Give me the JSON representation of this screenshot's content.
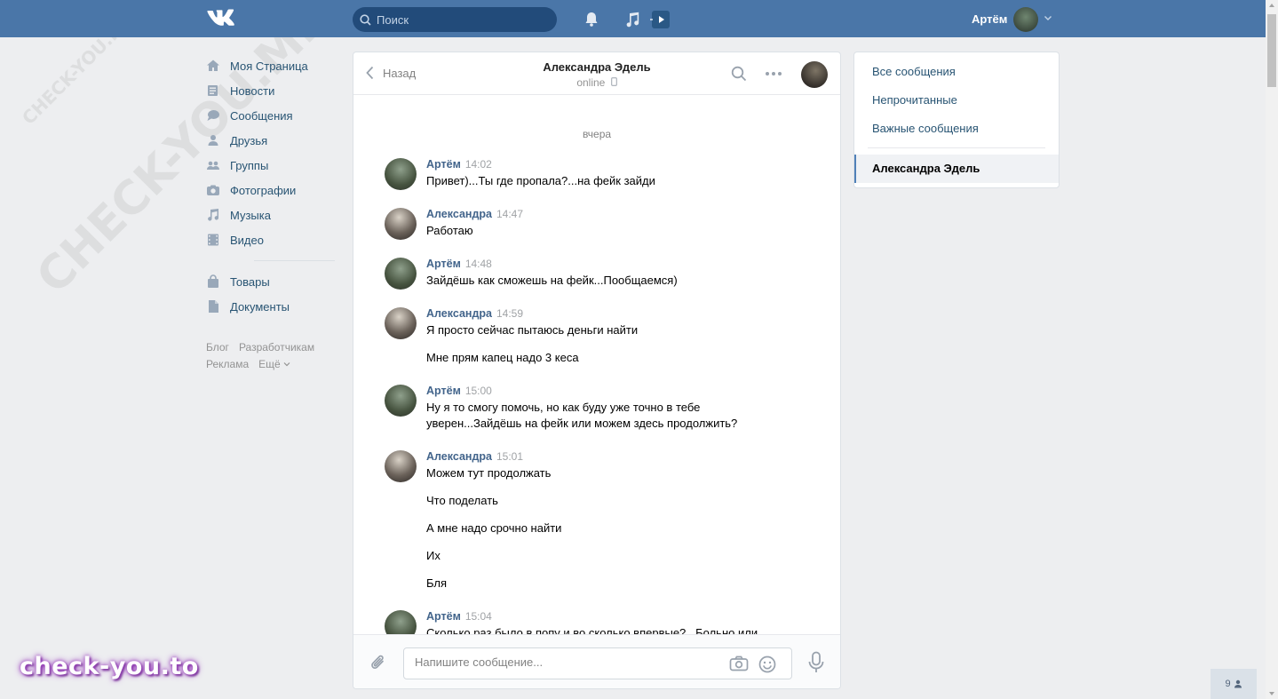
{
  "header": {
    "search_placeholder": "Поиск",
    "user_name": "Артём"
  },
  "watermark": {
    "big": "CHECK-YOU.ME",
    "small": "CHECK-YOU.ME"
  },
  "sidebar": {
    "items": [
      {
        "label": "Моя Страница",
        "icon": "home-icon"
      },
      {
        "label": "Новости",
        "icon": "news-icon"
      },
      {
        "label": "Сообщения",
        "icon": "messages-icon"
      },
      {
        "label": "Друзья",
        "icon": "friends-icon"
      },
      {
        "label": "Группы",
        "icon": "groups-icon"
      },
      {
        "label": "Фотографии",
        "icon": "camera-icon"
      },
      {
        "label": "Музыка",
        "icon": "music-icon"
      },
      {
        "label": "Видео",
        "icon": "video-icon"
      },
      {
        "label": "Товары",
        "icon": "bag-icon"
      },
      {
        "label": "Документы",
        "icon": "document-icon"
      }
    ],
    "footer": [
      "Блог",
      "Разработчикам",
      "Реклама",
      "Ещё"
    ]
  },
  "chat": {
    "back_label": "Назад",
    "peer_name": "Александра Эдель",
    "peer_status": "online",
    "day_label": "вчера",
    "messages": [
      {
        "author": "Артём",
        "time": "14:02",
        "lines": [
          "Привет)...Ты где пропала?...на фейк зайди"
        ]
      },
      {
        "author": "Александра",
        "time": "14:47",
        "lines": [
          "Работаю"
        ]
      },
      {
        "author": "Артём",
        "time": "14:48",
        "lines": [
          "Зайдёшь как сможешь на фейк...Пообщаемся)"
        ]
      },
      {
        "author": "Александра",
        "time": "14:59",
        "lines": [
          "Я просто сейчас пытаюсь деньги найти",
          "Мне прям капец надо 3 кеса"
        ]
      },
      {
        "author": "Артём",
        "time": "15:00",
        "lines": [
          "Ну я то смогу помочь, но как буду уже точно в тебе уверен...Зайдёшь на фейк или можем здесь продолжить?"
        ]
      },
      {
        "author": "Александра",
        "time": "15:01",
        "lines": [
          "Можем тут продолжать",
          "Что поделать",
          "А мне надо срочно найти",
          "Их",
          "Бля"
        ]
      },
      {
        "author": "Артём",
        "time": "15:04",
        "lines": [
          "Сколько раз было в попу и во сколько впервые?...Больно или"
        ]
      }
    ],
    "composer_placeholder": "Напишите сообщение..."
  },
  "right_panel": {
    "items": [
      "Все сообщения",
      "Непрочитанные",
      "Важные сообщения"
    ],
    "active": "Александра Эдель"
  },
  "brand": "check-you.to",
  "counter": "9"
}
